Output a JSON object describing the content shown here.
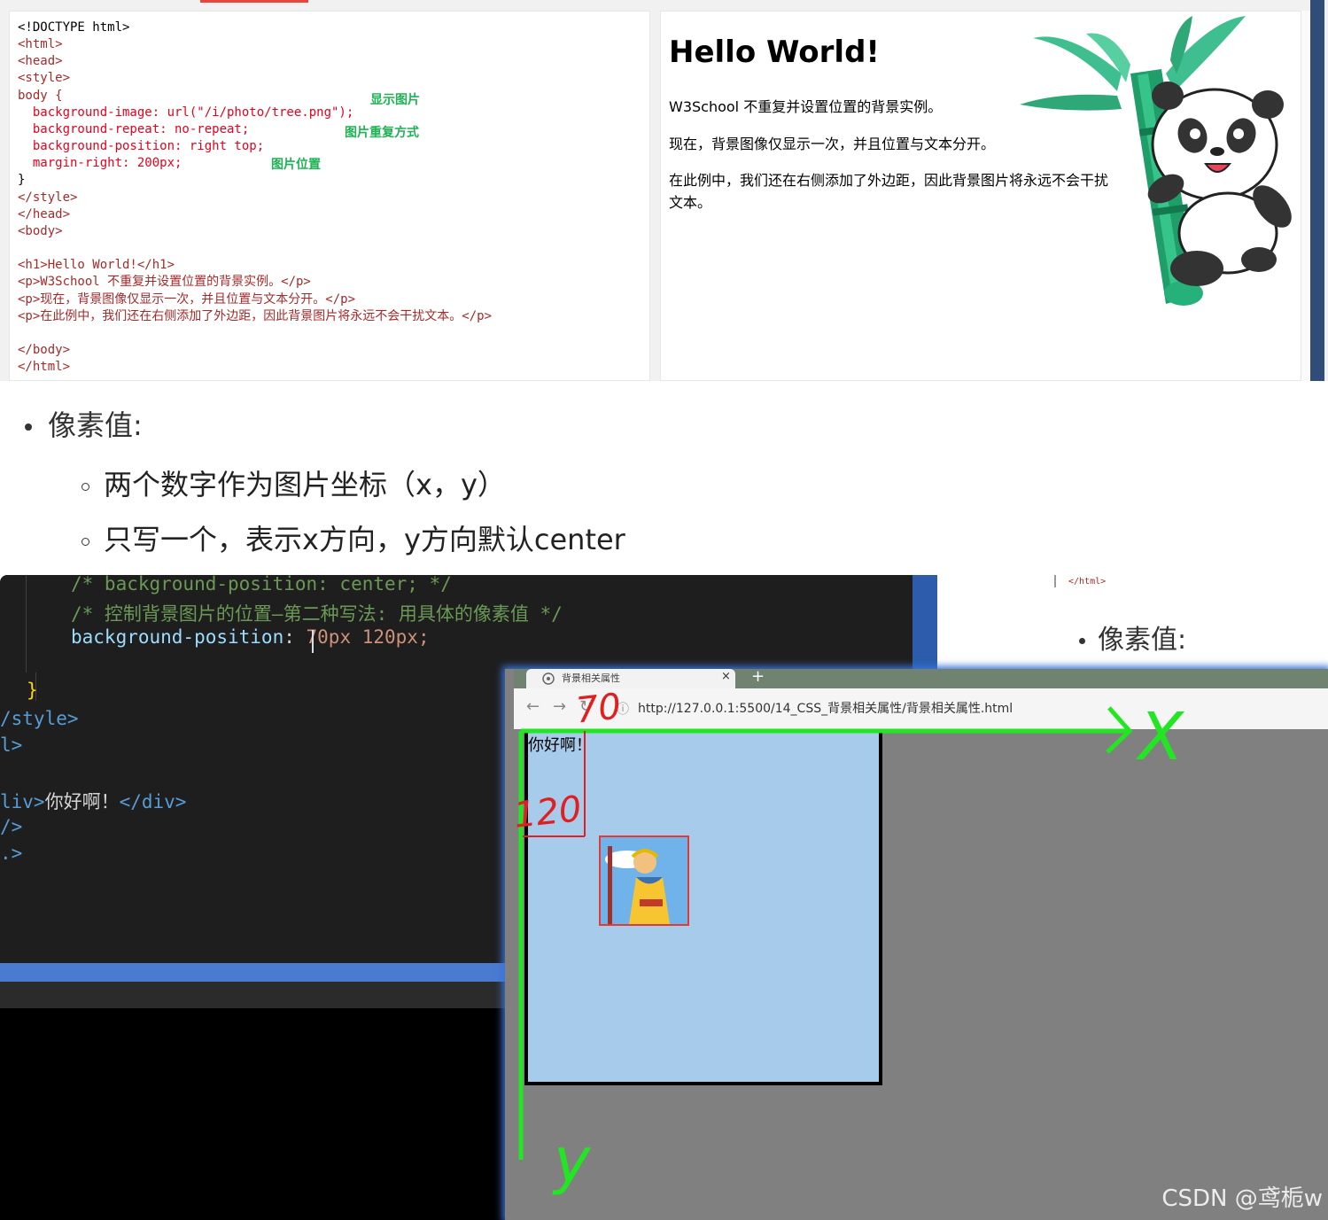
{
  "top": {
    "code_lines": [
      "<!DOCTYPE html>",
      "<html>",
      "<head>",
      "<style>",
      "body {",
      "  background-image: url(\"/i/photo/tree.png\");",
      "  background-repeat: no-repeat;",
      "  background-position: right top;",
      "  margin-right: 200px;",
      "}",
      "</style>",
      "</head>",
      "<body>",
      "",
      "<h1>Hello World!</h1>",
      "<p>W3School 不重复并设置位置的背景实例。</p>",
      "<p>现在，背景图像仅显示一次，并且位置与文本分开。</p>",
      "<p>在此例中，我们还在右侧添加了外边距，因此背景图片将永远不会干扰文本。</p>",
      "",
      "</body>",
      "</html>"
    ],
    "annotations": {
      "show_image": "显示图片",
      "repeat_mode": "图片重复方式",
      "image_position": "图片位置"
    },
    "preview": {
      "heading": "Hello World!",
      "p1": "W3School 不重复并设置位置的背景实例。",
      "p2": "现在，背景图像仅显示一次，并且位置与文本分开。",
      "p3": "在此例中，我们还在右侧添加了外边距，因此背景图片将永远不会干扰文本。"
    }
  },
  "bullets": {
    "main": "像素值:",
    "sub1": "两个数字作为图片坐标（x，y）",
    "sub2": "只写一个，表示x方向，y方向默认center"
  },
  "bottom": {
    "editor": {
      "line1": "/* background-position: center; */",
      "line2": "/* 控制背景图片的位置—第二种写法: 用具体的像素值 */",
      "line3_prop": "background-position",
      "line3_val": "70px 120px;",
      "brace": "}",
      "style_close": "/style>",
      "head_close": "l>",
      "div_open": "liv>",
      "div_text": "你好啊！",
      "div_close": "</div>",
      "l6": "/>",
      "l7": ".>"
    },
    "right_doc": {
      "html_end": "</html>",
      "bullet": "像素值:"
    },
    "browser": {
      "tab_title": "背景相关属性",
      "tab_close": "×",
      "new_tab": "+",
      "url": "http://127.0.0.1:5500/14_CSS_背景相关属性/背景相关属性.html",
      "div_text": "你好啊！"
    },
    "handwriting": {
      "x_value": "70",
      "y_value": "120",
      "x_axis": "X",
      "y_axis": "y"
    }
  },
  "watermark": "CSDN @鸢栀w"
}
